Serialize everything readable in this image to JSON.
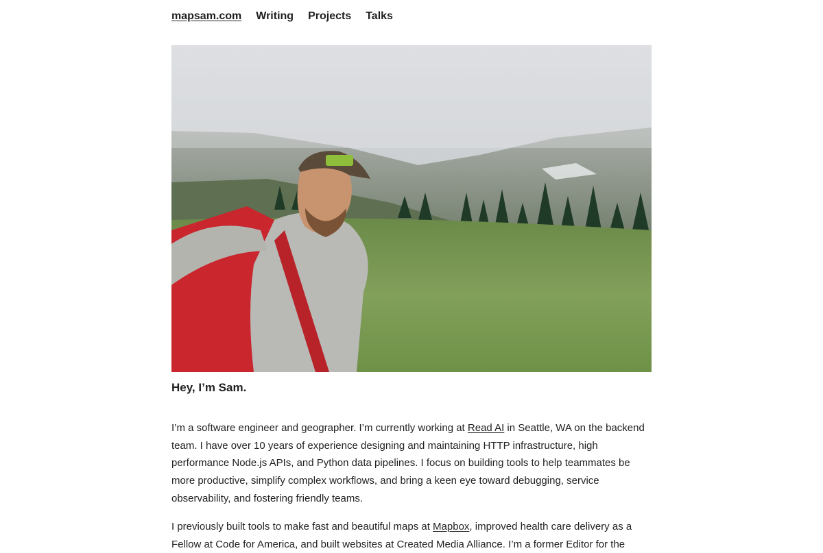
{
  "nav": {
    "home": "mapsam.com",
    "writing": "Writing",
    "projects": "Projects",
    "talks": "Talks"
  },
  "hero": {
    "kind": "photo",
    "colors": {
      "sky": "#cfd2d6",
      "fog": "#9aa29e",
      "meadow": "#7c9b55",
      "backpack": "#c9262d",
      "shirt": "#b8b8b4",
      "cap": "#5a4a3a"
    }
  },
  "intro": {
    "heading": "Hey, I’m Sam.",
    "p1_before": "I’m a software engineer and geographer. I’m currently working at ",
    "p1_link": "Read AI",
    "p1_after": " in Seattle, WA on the backend team. I have over 10 years of experience designing and maintaining HTTP infrastructure, high performance Node.js APIs, and Python data pipelines. I focus on building tools to help teammates be more productive, simplify complex workflows, and bring a keen eye toward debugging, service observability, and fostering friendly teams.",
    "p2_before": "I previously built tools to make fast and beautiful maps at ",
    "p2_link": "Mapbox",
    "p2_after": ", improved health care delivery as a Fellow at Code for America, and built websites at Created Media Alliance. I’m a former Editor for the"
  }
}
